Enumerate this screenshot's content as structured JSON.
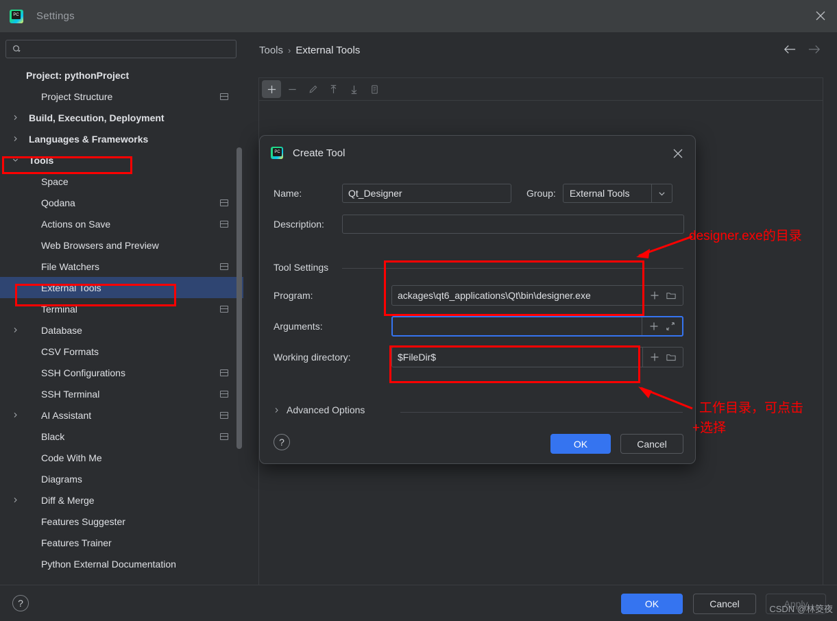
{
  "window": {
    "title": "Settings",
    "app_icon": "pycharm-logo-icon",
    "close_icon": "close-icon"
  },
  "sidebar": {
    "search": {
      "placeholder": "",
      "value": "",
      "icon": "search-icon"
    },
    "items": [
      {
        "label": "Project: pythonProject",
        "level": "root",
        "arrow": "",
        "badge": false
      },
      {
        "label": "Project Structure",
        "level": "child",
        "arrow": "",
        "badge": true
      },
      {
        "label": "Build, Execution, Deployment",
        "level": "top",
        "arrow": "right",
        "badge": false
      },
      {
        "label": "Languages & Frameworks",
        "level": "top",
        "arrow": "right",
        "badge": false
      },
      {
        "label": "Tools",
        "level": "top",
        "arrow": "down",
        "badge": false,
        "highlight_red": true
      },
      {
        "label": "Space",
        "level": "child",
        "arrow": "",
        "badge": false
      },
      {
        "label": "Qodana",
        "level": "child",
        "arrow": "",
        "badge": true
      },
      {
        "label": "Actions on Save",
        "level": "child",
        "arrow": "",
        "badge": true
      },
      {
        "label": "Web Browsers and Preview",
        "level": "child",
        "arrow": "",
        "badge": false
      },
      {
        "label": "File Watchers",
        "level": "child",
        "arrow": "",
        "badge": true
      },
      {
        "label": "External Tools",
        "level": "child",
        "arrow": "",
        "badge": false,
        "selected": true,
        "highlight_red": true
      },
      {
        "label": "Terminal",
        "level": "child",
        "arrow": "",
        "badge": true
      },
      {
        "label": "Database",
        "level": "child",
        "arrow": "right",
        "badge": false
      },
      {
        "label": "CSV Formats",
        "level": "child",
        "arrow": "",
        "badge": false
      },
      {
        "label": "SSH Configurations",
        "level": "child",
        "arrow": "",
        "badge": true
      },
      {
        "label": "SSH Terminal",
        "level": "child",
        "arrow": "",
        "badge": true
      },
      {
        "label": "AI Assistant",
        "level": "child",
        "arrow": "right",
        "badge": true
      },
      {
        "label": "Black",
        "level": "child",
        "arrow": "",
        "badge": true
      },
      {
        "label": "Code With Me",
        "level": "child",
        "arrow": "",
        "badge": false
      },
      {
        "label": "Diagrams",
        "level": "child",
        "arrow": "",
        "badge": false
      },
      {
        "label": "Diff & Merge",
        "level": "child",
        "arrow": "right",
        "badge": false
      },
      {
        "label": "Features Suggester",
        "level": "child",
        "arrow": "",
        "badge": false
      },
      {
        "label": "Features Trainer",
        "level": "child",
        "arrow": "",
        "badge": false
      },
      {
        "label": "Python External Documentation",
        "level": "child",
        "arrow": "",
        "badge": false
      }
    ]
  },
  "main": {
    "breadcrumb": {
      "parent": "Tools",
      "separator": "›",
      "current": "External Tools"
    },
    "nav": {
      "back_icon": "arrow-left-icon",
      "forward_icon": "arrow-right-icon"
    },
    "toolbar": [
      {
        "name": "add-tool-button",
        "icon": "plus-icon",
        "state": "active"
      },
      {
        "name": "remove-tool-button",
        "icon": "minus-icon",
        "state": "disabled"
      },
      {
        "name": "edit-tool-button",
        "icon": "pencil-icon",
        "state": "disabled"
      },
      {
        "name": "move-up-button",
        "icon": "arrow-up-icon",
        "state": "disabled"
      },
      {
        "name": "move-down-button",
        "icon": "arrow-down-icon",
        "state": "disabled"
      },
      {
        "name": "copy-tool-button",
        "icon": "copy-icon",
        "state": "disabled"
      }
    ]
  },
  "dialog": {
    "title": "Create Tool",
    "icon": "pycharm-logo-icon",
    "close_icon": "close-icon",
    "name_label": "Name:",
    "name_value": "Qt_Designer",
    "group_label": "Group:",
    "group_value": "External Tools",
    "group_caret_icon": "chevron-down-icon",
    "description_label": "Description:",
    "description_value": "",
    "tool_settings_label": "Tool Settings",
    "program_label": "Program:",
    "program_value": "ackages\\qt6_applications\\Qt\\bin\\designer.exe",
    "arguments_label": "Arguments:",
    "arguments_value": "",
    "working_directory_label": "Working directory:",
    "working_directory_value": "$FileDir$",
    "insert_macro_icon": "plus-icon",
    "browse_folder_icon": "folder-icon",
    "expand_icon": "expand-diagonal-icon",
    "advanced_options_label": "Advanced Options",
    "advanced_arrow_icon": "chevron-right-icon",
    "help_label": "?",
    "ok_label": "OK",
    "cancel_label": "Cancel"
  },
  "footer": {
    "help_label": "?",
    "ok_label": "OK",
    "cancel_label": "Cancel",
    "apply_label": "Apply"
  },
  "annotations": [
    {
      "id": "program-note",
      "text": "designer.exe的目录"
    },
    {
      "id": "workdir-note-line1",
      "text": "工作目录，可点击"
    },
    {
      "id": "workdir-note-line2",
      "text": "+选择"
    }
  ],
  "watermark": {
    "text": "CSDN @林筊夜"
  },
  "colors": {
    "background": "#2b2d30",
    "titlebar": "#3c3f41",
    "selection": "#2f4572",
    "accent": "#3574f0",
    "annotation": "#ff0000",
    "text": "#dfe1e5"
  }
}
